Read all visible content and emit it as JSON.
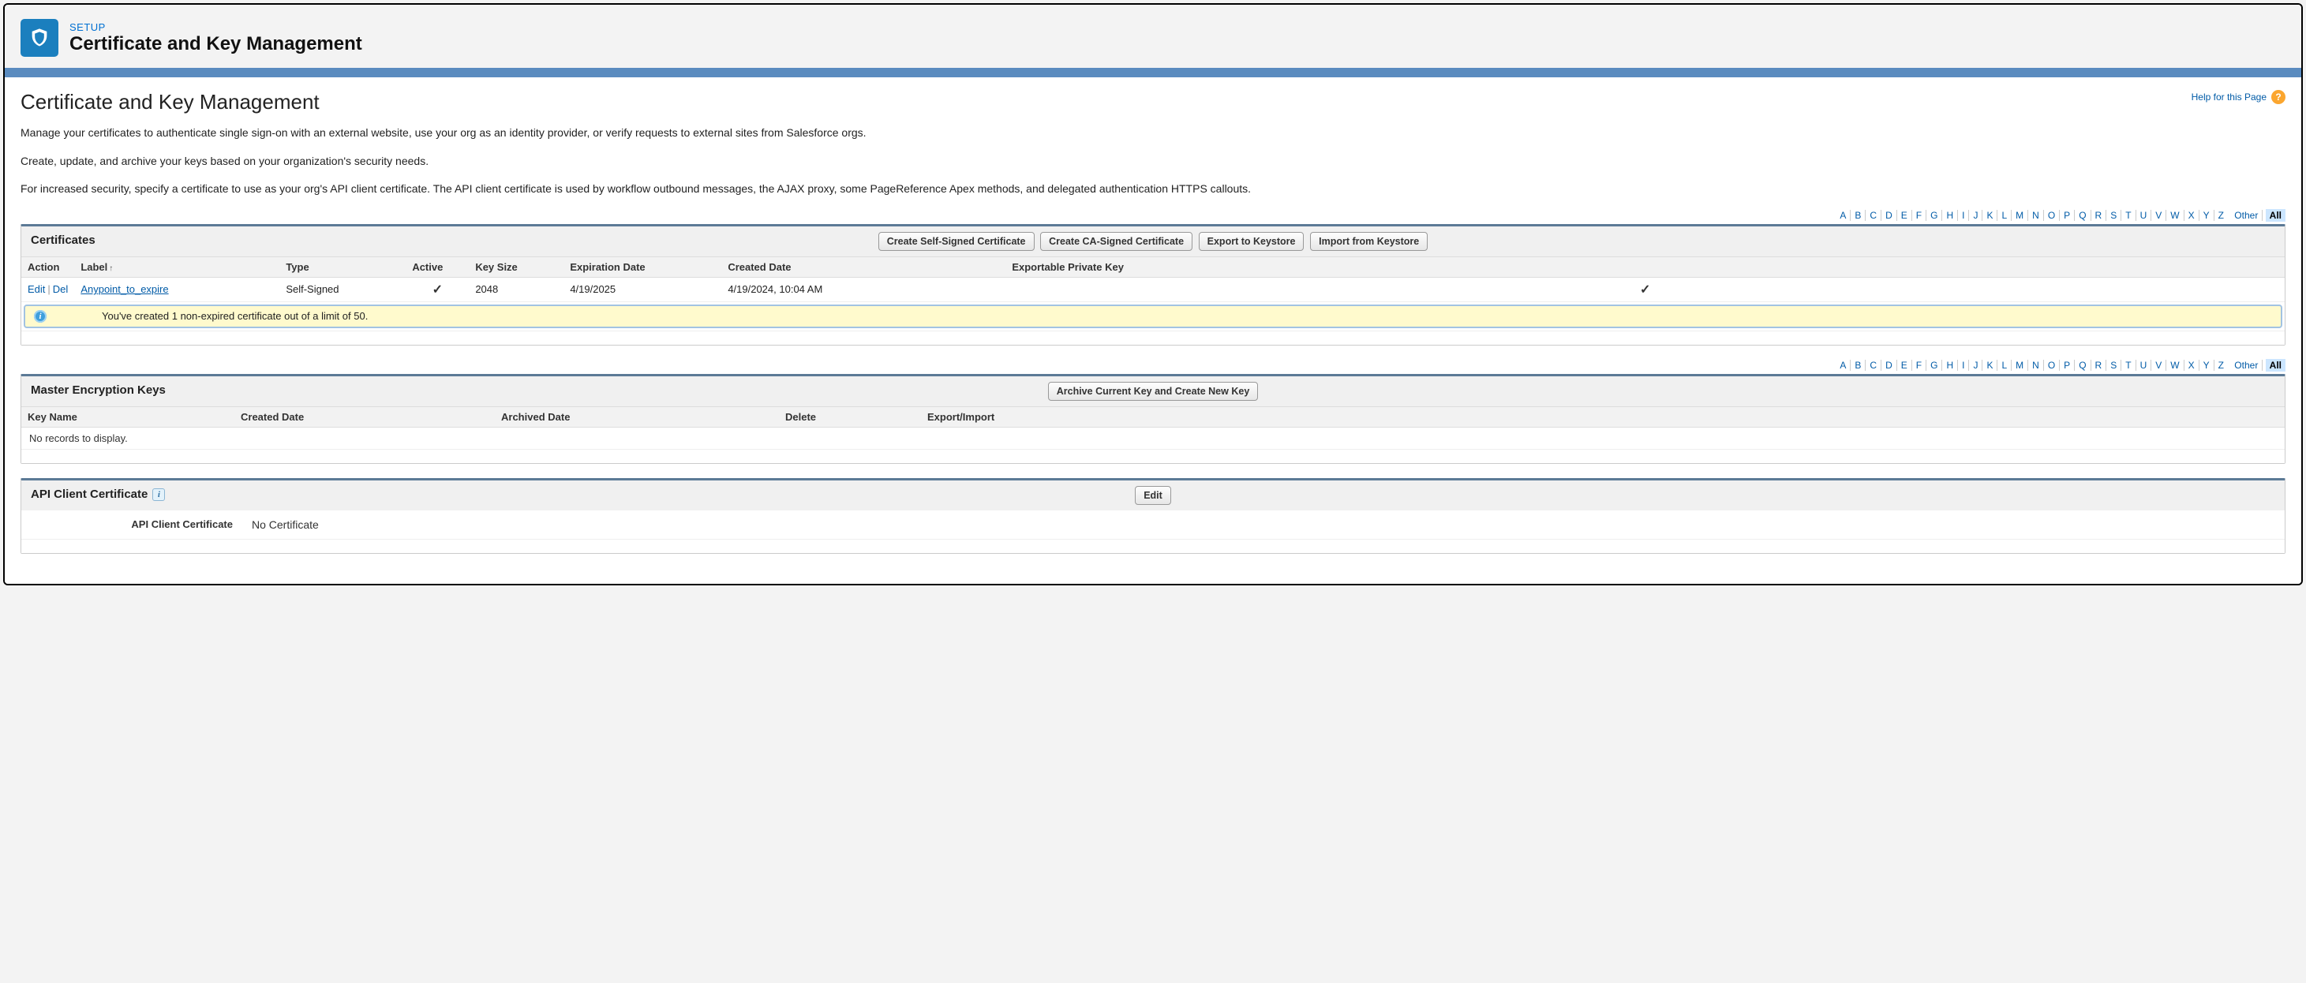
{
  "header": {
    "setup": "SETUP",
    "title": "Certificate and Key Management"
  },
  "page": {
    "title": "Certificate and Key Management",
    "help_label": "Help for this Page",
    "desc1": "Manage your certificates to authenticate single sign-on with an external website, use your org as an identity provider, or verify requests to external sites from Salesforce orgs.",
    "desc2": "Create, update, and archive your keys based on your organization's security needs.",
    "desc3": "For increased security, specify a certificate to use as your org's API client certificate. The API client certificate is used by workflow outbound messages, the AJAX proxy, some PageReference Apex methods, and delegated authentication HTTPS callouts."
  },
  "alpha": {
    "letters": "ABCDEFGHIJKLMNOPQRSTUVWXYZ",
    "other": "Other",
    "all": "All"
  },
  "certificates": {
    "title": "Certificates",
    "buttons": {
      "create_self": "Create Self-Signed Certificate",
      "create_ca": "Create CA-Signed Certificate",
      "export": "Export to Keystore",
      "import": "Import from Keystore"
    },
    "headers": {
      "action": "Action",
      "label": "Label",
      "type": "Type",
      "active": "Active",
      "keysize": "Key Size",
      "expiration": "Expiration Date",
      "created": "Created Date",
      "exportable": "Exportable Private Key"
    },
    "row": {
      "edit": "Edit",
      "del": "Del",
      "label": "Anypoint_to_expire",
      "type": "Self-Signed",
      "keysize": "2048",
      "expiration": "4/19/2025",
      "created": "4/19/2024, 10:04 AM"
    },
    "info": "You've created 1 non-expired certificate out of a limit of 50."
  },
  "master": {
    "title": "Master Encryption Keys",
    "buttons": {
      "archive": "Archive Current Key and Create New Key"
    },
    "headers": {
      "keyname": "Key Name",
      "created": "Created Date",
      "archived": "Archived Date",
      "delete": "Delete",
      "export": "Export/Import"
    },
    "empty": "No records to display."
  },
  "api": {
    "title": "API Client Certificate",
    "buttons": {
      "edit": "Edit"
    },
    "label": "API Client Certificate",
    "value": "No Certificate"
  }
}
